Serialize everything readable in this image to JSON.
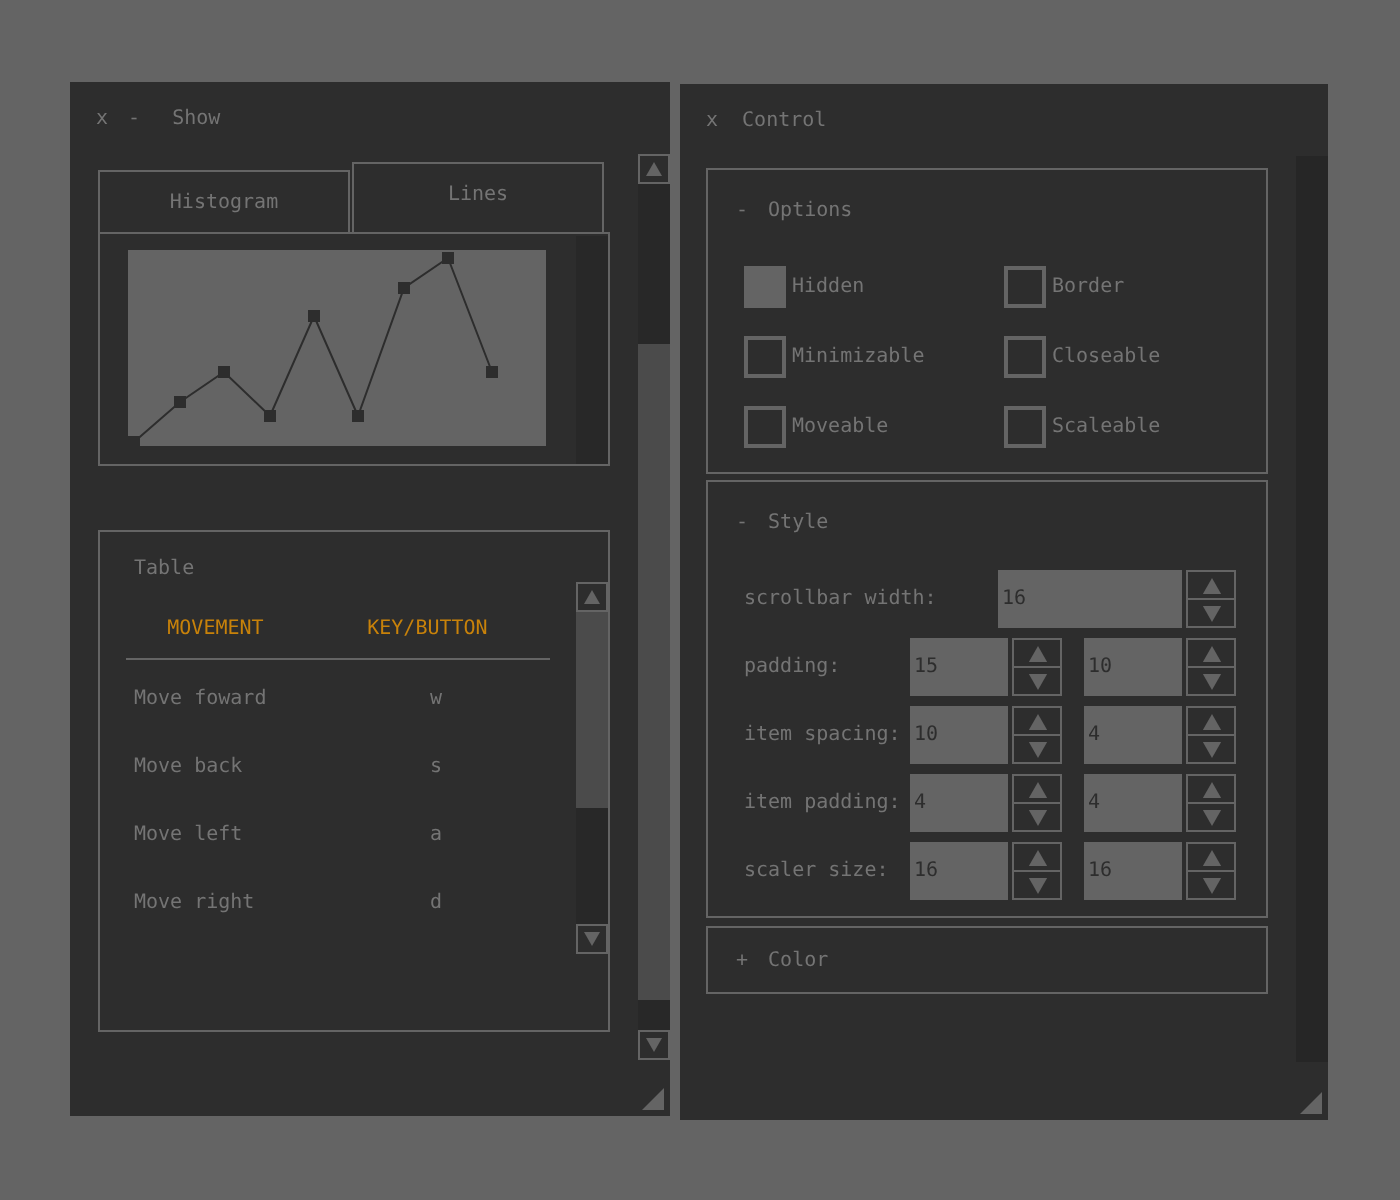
{
  "show_window": {
    "close": "x",
    "minimize": "-",
    "title": "Show",
    "tabs": [
      {
        "label": "Histogram",
        "selected": false
      },
      {
        "label": "Lines",
        "selected": true
      }
    ],
    "table": {
      "title": "Table",
      "columns": [
        "MOVEMENT",
        "KEY/BUTTON"
      ],
      "rows": [
        [
          "Move foward",
          "w"
        ],
        [
          "Move back",
          "s"
        ],
        [
          "Move left",
          "a"
        ],
        [
          "Move right",
          "d"
        ]
      ]
    }
  },
  "control_window": {
    "close": "x",
    "title": "Control",
    "groups": [
      {
        "toggle": "-",
        "title": "Options",
        "expanded": true,
        "kind": "checkboxes",
        "options": [
          {
            "label": "Hidden",
            "checked": true
          },
          {
            "label": "Border",
            "checked": false
          },
          {
            "label": "Minimizable",
            "checked": false
          },
          {
            "label": "Closeable",
            "checked": false
          },
          {
            "label": "Moveable",
            "checked": false
          },
          {
            "label": "Scaleable",
            "checked": false
          }
        ]
      },
      {
        "toggle": "-",
        "title": "Style",
        "expanded": true,
        "kind": "properties",
        "properties": [
          {
            "label": "scrollbar width:",
            "values": [
              "16"
            ]
          },
          {
            "label": "padding:",
            "values": [
              "15",
              "10"
            ]
          },
          {
            "label": "item spacing:",
            "values": [
              "10",
              "4"
            ]
          },
          {
            "label": "item padding:",
            "values": [
              "4",
              "4"
            ]
          },
          {
            "label": "scaler size:",
            "values": [
              "16",
              "16"
            ]
          }
        ]
      },
      {
        "toggle": "+",
        "title": "Color",
        "expanded": false
      }
    ]
  }
}
